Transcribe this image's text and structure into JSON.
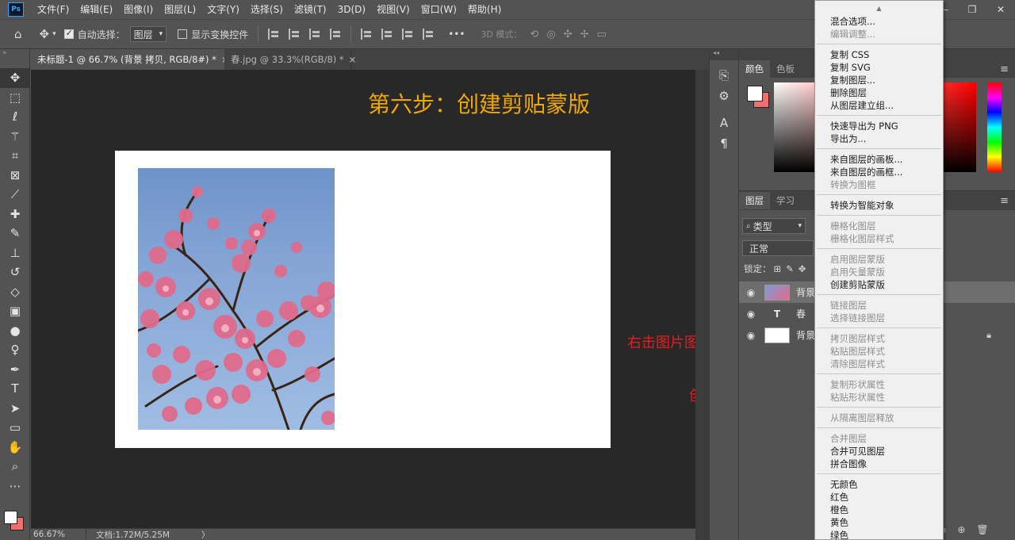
{
  "menubar": {
    "logo": "Ps",
    "items": [
      "文件(F)",
      "编辑(E)",
      "图像(I)",
      "图层(L)",
      "文字(Y)",
      "选择(S)",
      "滤镜(T)",
      "3D(D)",
      "视图(V)",
      "窗口(W)",
      "帮助(H)"
    ],
    "window_controls": [
      "—",
      "❐",
      "✕"
    ]
  },
  "options": {
    "auto_select_label": "自动选择：",
    "auto_select_target": "图层",
    "show_transform_label": "显示变换控件",
    "mode3d_label": "3D 模式：",
    "more": "•••"
  },
  "doc_tabs": [
    {
      "title": "未标题-1 @ 66.7% (背景 拷贝, RGB/8#) *",
      "close": "×"
    },
    {
      "title": "春.jpg @ 33.3%(RGB/8) *",
      "close": "×"
    }
  ],
  "canvas": {
    "step_title": "第六步：创建剪贴蒙版",
    "annotations": {
      "right_click": "右击图片图层",
      "create_clip": "创建剪贴蒙版"
    },
    "colors": {
      "step_title": "#f0a800",
      "annotation": "#e02020"
    }
  },
  "status": {
    "zoom": "66.67%",
    "doc_info": "文档:1.72M/5.25M",
    "arrow": "〉"
  },
  "color_panel": {
    "tabs": [
      "颜色",
      "色板"
    ],
    "fg_color": "#ffffff",
    "bg_color": "#f06f6f"
  },
  "layers_panel": {
    "tabs": [
      "图层",
      "学习"
    ],
    "filter_label": "类型",
    "blend_mode": "正常",
    "lock_label": "锁定：",
    "layers": [
      {
        "name": "背景",
        "type": "image",
        "selected": true
      },
      {
        "name": "春",
        "type": "text",
        "selected": false
      },
      {
        "name": "背景",
        "type": "fill",
        "selected": false
      }
    ]
  },
  "context_menu": {
    "groups": [
      [
        {
          "label": "混合选项...",
          "enabled": true
        },
        {
          "label": "编辑调整...",
          "enabled": false
        }
      ],
      [
        {
          "label": "复制 CSS",
          "enabled": true
        },
        {
          "label": "复制 SVG",
          "enabled": true
        },
        {
          "label": "复制图层...",
          "enabled": true
        },
        {
          "label": "删除图层",
          "enabled": true
        },
        {
          "label": "从图层建立组...",
          "enabled": true
        }
      ],
      [
        {
          "label": "快速导出为 PNG",
          "enabled": true
        },
        {
          "label": "导出为...",
          "enabled": true
        }
      ],
      [
        {
          "label": "来自图层的画板...",
          "enabled": true
        },
        {
          "label": "来自图层的画框...",
          "enabled": true
        },
        {
          "label": "转换为图框",
          "enabled": false
        }
      ],
      [
        {
          "label": "转换为智能对象",
          "enabled": true
        }
      ],
      [
        {
          "label": "栅格化图层",
          "enabled": false
        },
        {
          "label": "栅格化图层样式",
          "enabled": false
        }
      ],
      [
        {
          "label": "启用图层蒙版",
          "enabled": false
        },
        {
          "label": "启用矢量蒙版",
          "enabled": false
        },
        {
          "label": "创建剪贴蒙版",
          "enabled": true
        }
      ],
      [
        {
          "label": "链接图层",
          "enabled": false
        },
        {
          "label": "选择链接图层",
          "enabled": false
        }
      ],
      [
        {
          "label": "拷贝图层样式",
          "enabled": false
        },
        {
          "label": "粘贴图层样式",
          "enabled": false
        },
        {
          "label": "清除图层样式",
          "enabled": false
        }
      ],
      [
        {
          "label": "复制形状属性",
          "enabled": false
        },
        {
          "label": "粘贴形状属性",
          "enabled": false
        }
      ],
      [
        {
          "label": "从隔离图层释放",
          "enabled": false
        }
      ],
      [
        {
          "label": "合并图层",
          "enabled": false
        },
        {
          "label": "合并可见图层",
          "enabled": true
        },
        {
          "label": "拼合图像",
          "enabled": true
        }
      ],
      [
        {
          "label": "无颜色",
          "enabled": true
        },
        {
          "label": "红色",
          "enabled": true
        },
        {
          "label": "橙色",
          "enabled": true
        },
        {
          "label": "黄色",
          "enabled": true
        },
        {
          "label": "绿色",
          "enabled": true
        }
      ]
    ]
  }
}
